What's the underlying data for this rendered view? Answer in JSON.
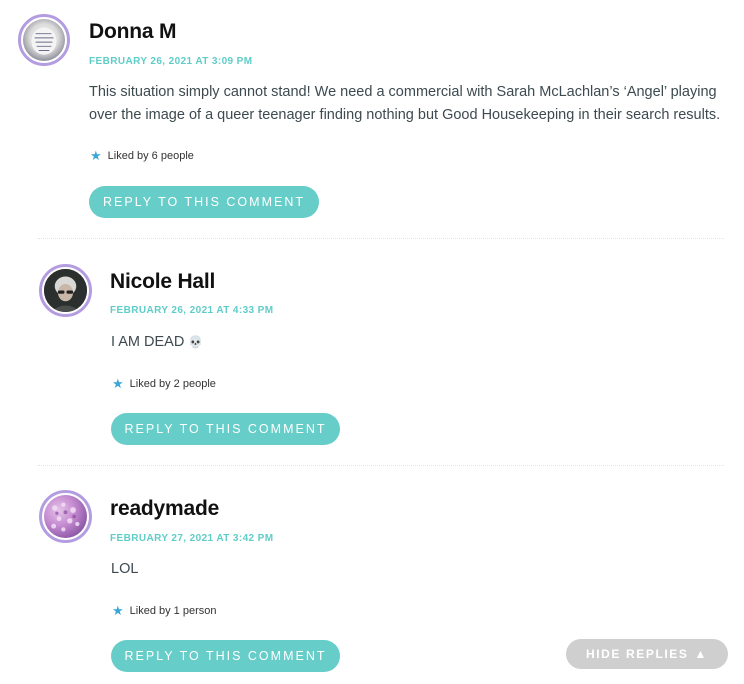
{
  "comments": [
    {
      "author": "Donna M",
      "date": "FEBRUARY 26, 2021 AT 3:09 PM",
      "body_line1": "This situation simply cannot stand! We need a commercial with Sarah McLachlan’s ‘Angel’ playing",
      "body_line2": "over the image of a queer teenager finding nothing but Good Housekeeping in their search results.",
      "likes": "Liked by 6 people",
      "reply_label": "REPLY TO THIS COMMENT"
    },
    {
      "author": "Nicole Hall",
      "date": "FEBRUARY 26, 2021 AT 4:33 PM",
      "body": "I AM DEAD",
      "body_emoji": "💀",
      "likes": "Liked by 2 people",
      "reply_label": "REPLY TO THIS COMMENT"
    },
    {
      "author": "readymade",
      "date": "FEBRUARY 27, 2021 AT 3:42 PM",
      "body": "LOL",
      "likes": "Liked by 1 person",
      "reply_label": "REPLY TO THIS COMMENT"
    }
  ],
  "hide_replies": {
    "label": "HIDE REPLIES",
    "arrow": "▲"
  },
  "icons": {
    "like": "star-icon"
  },
  "colors": {
    "accent": "#66cdc8",
    "date": "#5fcdc7",
    "avatar_ring": "#b39de0",
    "hide_replies_bg": "#cfcfcf",
    "star": "#3aa7d6"
  }
}
